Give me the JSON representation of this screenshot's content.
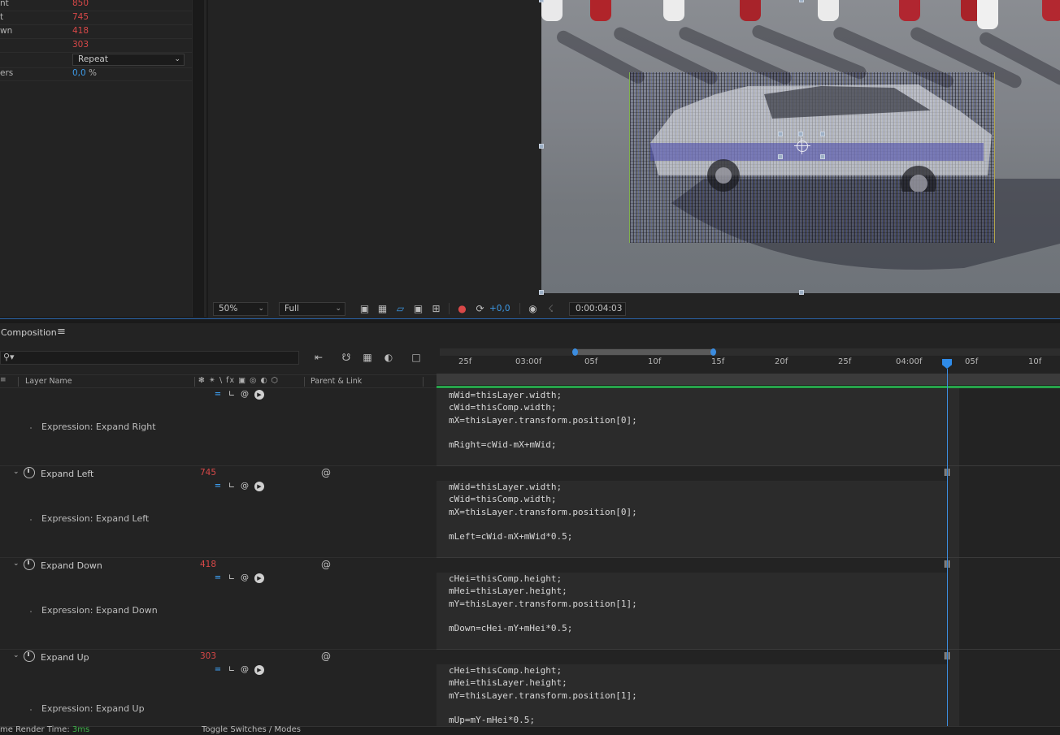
{
  "effect_controls": {
    "rows": [
      {
        "label": "nt",
        "value": "850"
      },
      {
        "label": "t",
        "value": "745"
      },
      {
        "label": "wn",
        "value": "418"
      },
      {
        "label": "",
        "value": "303"
      },
      {
        "label": "",
        "select": "Repeat"
      },
      {
        "label": "ers",
        "value": "0,0",
        "unit": "%"
      }
    ]
  },
  "viewer_toolbar": {
    "zoom": "50%",
    "resolution": "Full",
    "exposure": "+0,0",
    "timecode": "0:00:04:03"
  },
  "timeline": {
    "panel_title": "Composition",
    "columns": {
      "layer_name": "Layer Name",
      "switches": "❃ ✴ \\ fx ▣ ◎ ◐ ⬡",
      "parent": "Parent & Link"
    },
    "ruler": [
      "25f",
      "03:00f",
      "05f",
      "10f",
      "15f",
      "20f",
      "25f",
      "04:00f",
      "05f",
      "10f"
    ],
    "properties": [
      {
        "name": "Expand Left",
        "value": "745"
      },
      {
        "name": "Expand Down",
        "value": "418"
      },
      {
        "name": "Expand Up",
        "value": "303"
      }
    ],
    "expressions": [
      {
        "label": "Expression: Expand Right",
        "code": "mWid=thisLayer.width;\ncWid=thisComp.width;\nmX=thisLayer.transform.position[0];\n\nmRight=cWid-mX+mWid;"
      },
      {
        "label": "Expression: Expand Left",
        "code": "mWid=thisLayer.width;\ncWid=thisComp.width;\nmX=thisLayer.transform.position[0];\n\nmLeft=cWid-mX+mWid*0.5;"
      },
      {
        "label": "Expression: Expand Down",
        "code": "cHei=thisComp.height;\nmHei=thisLayer.height;\nmY=thisLayer.transform.position[1];\n\nmDown=cHei-mY+mHei*0.5;"
      },
      {
        "label": "Expression: Expand Up",
        "code": "cHei=thisComp.height;\nmHei=thisLayer.height;\nmY=thisLayer.transform.position[1];\n\nmUp=mY-mHei*0.5;"
      }
    ]
  },
  "status_bar": {
    "render_label": "me Render Time:",
    "render_value": "3ms",
    "toggle_label": "Toggle Switches / Modes"
  }
}
